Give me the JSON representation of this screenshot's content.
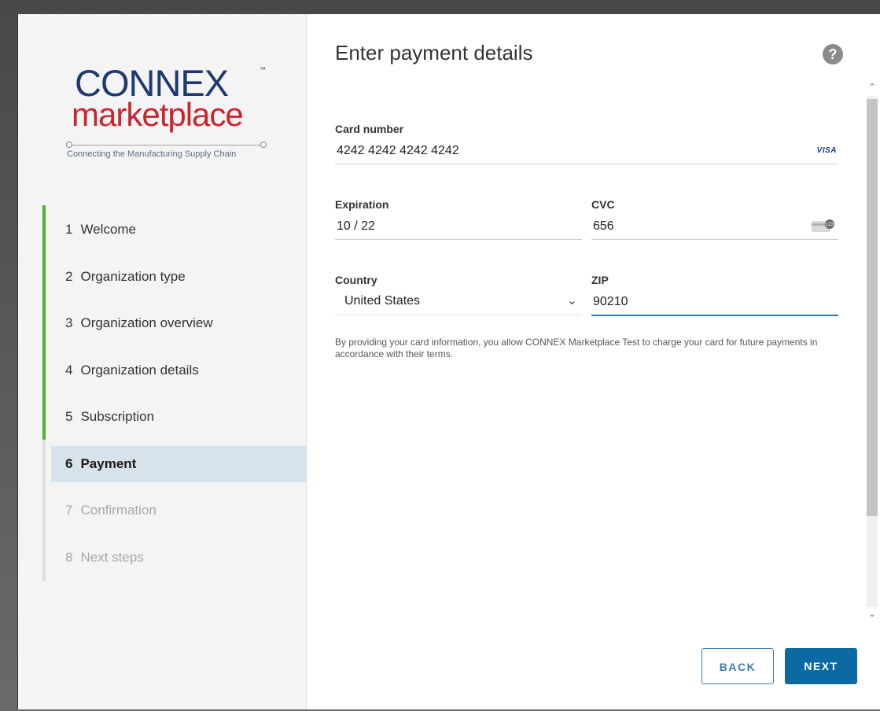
{
  "logo": {
    "brand": "CONNEX",
    "trademark": "™",
    "product": "marketplace",
    "tagline": "Connecting the Manufacturing Supply Chain"
  },
  "steps": [
    {
      "num": "1",
      "label": "Welcome",
      "state": "done"
    },
    {
      "num": "2",
      "label": "Organization type",
      "state": "done"
    },
    {
      "num": "3",
      "label": "Organization overview",
      "state": "done"
    },
    {
      "num": "4",
      "label": "Organization details",
      "state": "done"
    },
    {
      "num": "5",
      "label": "Subscription",
      "state": "done"
    },
    {
      "num": "6",
      "label": "Payment",
      "state": "active"
    },
    {
      "num": "7",
      "label": "Confirmation",
      "state": "future"
    },
    {
      "num": "8",
      "label": "Next steps",
      "state": "future"
    }
  ],
  "steps_completed": 5,
  "main": {
    "title": "Enter payment details",
    "help_icon": "?",
    "card_number": {
      "label": "Card number",
      "value": "4242 4242 4242 4242",
      "brand": "VISA"
    },
    "expiration": {
      "label": "Expiration",
      "value": "10 / 22"
    },
    "cvc": {
      "label": "CVC",
      "value": "656",
      "icon": "card-cvc-icon"
    },
    "country": {
      "label": "Country",
      "value": "United States"
    },
    "zip": {
      "label": "ZIP",
      "value": "90210"
    },
    "disclaimer": "By providing your card information, you allow CONNEX Marketplace Test to charge your card for future payments in accordance with their terms."
  },
  "buttons": {
    "back": "BACK",
    "next": "NEXT"
  },
  "colors": {
    "progress": "#5aac2f",
    "primary": "#0b6aa2",
    "brand_blue": "#1e3a6e",
    "brand_red": "#c8262c"
  }
}
